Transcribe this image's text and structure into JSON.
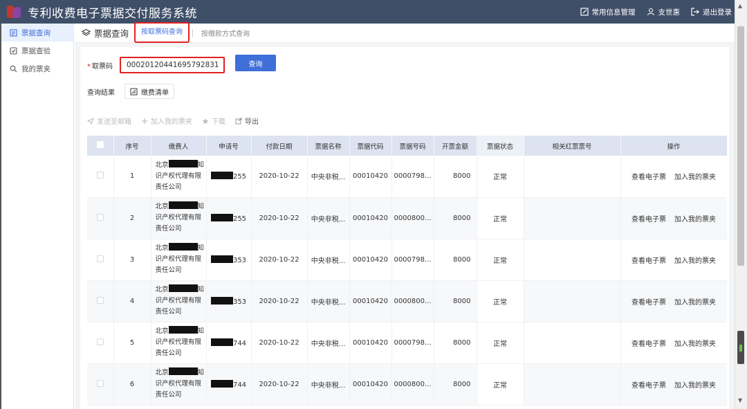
{
  "header": {
    "title": "专利收费电子票据交付服务系统",
    "links": [
      {
        "label": "常用信息管理",
        "icon": "edit-icon"
      },
      {
        "label": "支世惠",
        "icon": "user-icon"
      },
      {
        "label": "退出登录",
        "icon": "logout-icon"
      }
    ]
  },
  "sidebar": {
    "items": [
      {
        "label": "票据查询",
        "icon": "document-icon",
        "active": true
      },
      {
        "label": "票据查验",
        "icon": "check-box-icon",
        "active": false
      },
      {
        "label": "我的票夹",
        "icon": "search-icon",
        "active": false
      }
    ]
  },
  "tabs": {
    "section_title": "票据查询",
    "items": [
      {
        "label": "按取票码查询",
        "active": true
      },
      {
        "label": "按缴款方式查询",
        "active": false
      }
    ]
  },
  "form": {
    "required_mark": "*",
    "label": "取票码",
    "ticket_code": "00020120441695792831",
    "query_button": "查询"
  },
  "results": {
    "label": "查询结果",
    "fee_list_button": "缴费清单"
  },
  "toolbar": {
    "send_email": "发送至邮箱",
    "add_to_folder": "加入我的票夹",
    "download": "下载",
    "export": "导出"
  },
  "table": {
    "columns": [
      "序号",
      "缴费人",
      "申请号",
      "付款日期",
      "票据名称",
      "票据代码",
      "票据号码",
      "开票金额",
      "票据状态",
      "相关红票票号",
      "操作"
    ],
    "rows": [
      {
        "index": "1",
        "payer_line1": "北京",
        "payer_line1_end": "知",
        "payer_line2": "识产权代理有限",
        "payer_line3": "责任公司",
        "app_no_suffix": "255",
        "date": "2020-10-22",
        "name": "中央非税...",
        "code": "00010420",
        "number": "0000798...",
        "amount": "8000",
        "status": "正常",
        "red_no": ""
      },
      {
        "index": "2",
        "payer_line1": "北京",
        "payer_line1_end": "知",
        "payer_line2": "识产权代理有限",
        "payer_line3": "责任公司",
        "app_no_suffix": "255",
        "date": "2020-10-22",
        "name": "中央非税...",
        "code": "00010420",
        "number": "0000800...",
        "amount": "8000",
        "status": "正常",
        "red_no": ""
      },
      {
        "index": "3",
        "payer_line1": "北京",
        "payer_line1_end": "知",
        "payer_line2": "识产权代理有限",
        "payer_line3": "责任公司",
        "app_no_suffix": "353",
        "date": "2020-10-22",
        "name": "中央非税...",
        "code": "00010420",
        "number": "0000798...",
        "amount": "8000",
        "status": "正常",
        "red_no": ""
      },
      {
        "index": "4",
        "payer_line1": "北京",
        "payer_line1_end": "知",
        "payer_line2": "识产权代理有限",
        "payer_line3": "责任公司",
        "app_no_suffix": "353",
        "date": "2020-10-22",
        "name": "中央非税...",
        "code": "00010420",
        "number": "0000800...",
        "amount": "8000",
        "status": "正常",
        "red_no": ""
      },
      {
        "index": "5",
        "payer_line1": "北京",
        "payer_line1_end": "知",
        "payer_line2": "识产权代理有限",
        "payer_line3": "责任公司",
        "app_no_suffix": "744",
        "date": "2020-10-22",
        "name": "中央非税...",
        "code": "00010420",
        "number": "0000798...",
        "amount": "8000",
        "status": "正常",
        "red_no": ""
      },
      {
        "index": "6",
        "payer_line1": "北京",
        "payer_line1_end": "知",
        "payer_line2": "识产权代理有限",
        "payer_line3": "责任公司",
        "app_no_suffix": "744",
        "date": "2020-10-22",
        "name": "中央非税...",
        "code": "00010420",
        "number": "0000800...",
        "amount": "8000",
        "status": "正常",
        "red_no": ""
      }
    ],
    "row_actions": [
      "查看电子票",
      "加入我的票夹"
    ]
  },
  "colors": {
    "header_bg": "#3f4f68",
    "accent": "#3f6fd8",
    "highlight_box": "#e02020",
    "table_header_bg": "#dde3f0"
  }
}
